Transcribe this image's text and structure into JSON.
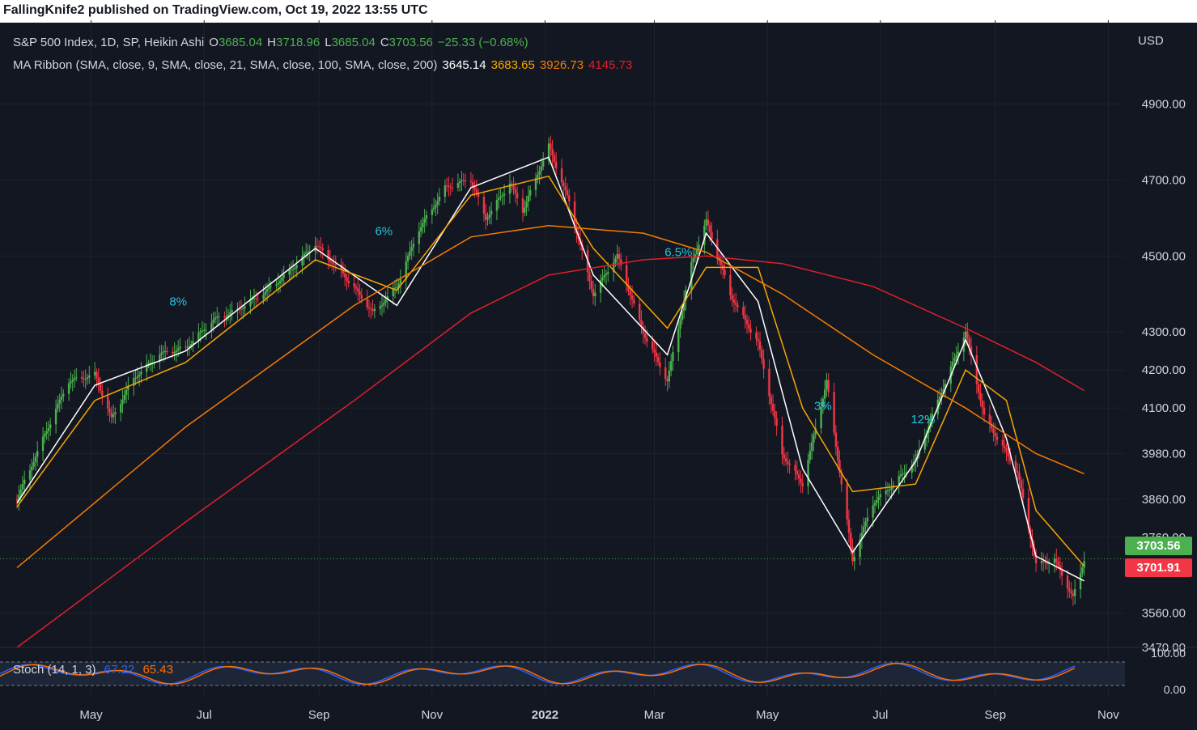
{
  "header": {
    "publisher": "FallingKnife2 published on TradingView.com, Oct 19, 2022 13:55 UTC"
  },
  "legend": {
    "symbol": "S&P 500 Index, 1D, SP, Heikin Ashi",
    "o_label": "O",
    "o_value": "3685.04",
    "h_label": "H",
    "h_value": "3718.96",
    "l_label": "L",
    "l_value": "3685.04",
    "c_label": "C",
    "c_value": "3703.56",
    "change": "−25.33 (−0.68%)",
    "ma_ribbon": "MA Ribbon (SMA, close, 9, SMA, close, 21, SMA, close, 100, SMA, close, 200)",
    "ma9": "3645.14",
    "ma21": "3683.65",
    "ma100": "3926.73",
    "ma200": "4145.73"
  },
  "currency": "USD",
  "price_badges": {
    "close": "3703.56",
    "ma": "3701.91"
  },
  "stoch": {
    "label": "Stoch (14, 1, 3)",
    "k": "67.22",
    "d": "65.43",
    "levels": [
      "100.00",
      "0.00"
    ]
  },
  "colors": {
    "up": "#4caf50",
    "down": "#f23645",
    "ma9": "#ffffff",
    "ma21": "#f7a600",
    "ma100": "#f57c00",
    "ma200": "#e0202a",
    "stoch_k": "#2962ff",
    "stoch_d": "#ff6d00",
    "annotation": "#26c6da"
  },
  "chart_data": {
    "type": "line",
    "title": "S&P 500 Index, 1D, SP, Heikin Ashi",
    "x_ticks": [
      "May",
      "Jul",
      "Sep",
      "Nov",
      "2022",
      "Mar",
      "May",
      "Jul",
      "Sep",
      "Nov"
    ],
    "y_ticks": [
      4900,
      4700,
      4500,
      4300,
      4200,
      4100,
      3980,
      3860,
      3760,
      3560,
      3470
    ],
    "ylim": [
      3470,
      4950
    ],
    "annotations": [
      "8%",
      "6%",
      "6.5%",
      "3%",
      "12%"
    ],
    "series": [
      {
        "name": "S&P 500 Index",
        "style": "heikin-ashi",
        "x": [
          "2021-03-22",
          "2021-04-05",
          "2021-04-19",
          "2021-05-03",
          "2021-05-12",
          "2021-05-24",
          "2021-06-07",
          "2021-06-21",
          "2021-07-06",
          "2021-07-19",
          "2021-08-02",
          "2021-08-16",
          "2021-08-30",
          "2021-09-13",
          "2021-09-30",
          "2021-10-13",
          "2021-10-25",
          "2021-11-08",
          "2021-11-22",
          "2021-11-30",
          "2021-12-13",
          "2021-12-20",
          "2022-01-03",
          "2022-01-14",
          "2022-01-27",
          "2022-02-09",
          "2022-02-23",
          "2022-03-08",
          "2022-03-21",
          "2022-03-29",
          "2022-04-11",
          "2022-04-26",
          "2022-05-09",
          "2022-05-20",
          "2022-06-02",
          "2022-06-16",
          "2022-06-27",
          "2022-07-08",
          "2022-07-20",
          "2022-08-01",
          "2022-08-16",
          "2022-08-26",
          "2022-09-07",
          "2022-09-13",
          "2022-09-23",
          "2022-10-03",
          "2022-10-13",
          "2022-10-19"
        ],
        "values": [
          3860,
          4020,
          4170,
          4190,
          4070,
          4180,
          4240,
          4260,
          4330,
          4360,
          4400,
          4460,
          4530,
          4460,
          4350,
          4420,
          4570,
          4680,
          4700,
          4600,
          4690,
          4620,
          4790,
          4640,
          4400,
          4500,
          4300,
          4170,
          4480,
          4590,
          4400,
          4270,
          3980,
          3900,
          4170,
          3700,
          3850,
          3900,
          3960,
          4120,
          4300,
          4080,
          3980,
          3930,
          3690,
          3700,
          3600,
          3703
        ]
      },
      {
        "name": "SMA 9",
        "x": [
          "2021-03-22",
          "2021-05-03",
          "2021-06-21",
          "2021-08-30",
          "2021-10-13",
          "2021-11-22",
          "2022-01-03",
          "2022-01-27",
          "2022-03-08",
          "2022-03-29",
          "2022-04-26",
          "2022-05-20",
          "2022-06-16",
          "2022-07-20",
          "2022-08-16",
          "2022-09-07",
          "2022-09-23",
          "2022-10-19"
        ],
        "values": [
          3850,
          4160,
          4250,
          4520,
          4370,
          4680,
          4760,
          4450,
          4240,
          4560,
          4380,
          3940,
          3720,
          3960,
          4280,
          4020,
          3710,
          3645
        ]
      },
      {
        "name": "SMA 21",
        "x": [
          "2021-03-22",
          "2021-05-03",
          "2021-06-21",
          "2021-08-30",
          "2021-10-13",
          "2021-11-22",
          "2022-01-03",
          "2022-01-27",
          "2022-03-08",
          "2022-03-29",
          "2022-04-26",
          "2022-05-20",
          "2022-06-16",
          "2022-07-20",
          "2022-08-16",
          "2022-09-07",
          "2022-09-23",
          "2022-10-19"
        ],
        "values": [
          3840,
          4120,
          4220,
          4490,
          4410,
          4660,
          4710,
          4520,
          4310,
          4470,
          4470,
          4100,
          3880,
          3900,
          4200,
          4120,
          3830,
          3684
        ]
      },
      {
        "name": "SMA 100",
        "x": [
          "2021-03-22",
          "2021-06-21",
          "2021-09-20",
          "2021-11-22",
          "2022-01-03",
          "2022-02-23",
          "2022-03-29",
          "2022-05-09",
          "2022-06-27",
          "2022-08-16",
          "2022-09-23",
          "2022-10-19"
        ],
        "values": [
          3680,
          4050,
          4370,
          4550,
          4580,
          4560,
          4510,
          4400,
          4240,
          4100,
          3980,
          3927
        ]
      },
      {
        "name": "SMA 200",
        "x": [
          "2021-03-22",
          "2021-06-21",
          "2021-09-20",
          "2021-11-22",
          "2022-01-03",
          "2022-02-23",
          "2022-03-29",
          "2022-05-09",
          "2022-06-27",
          "2022-08-16",
          "2022-09-23",
          "2022-10-19"
        ],
        "values": [
          3470,
          3800,
          4120,
          4350,
          4450,
          4490,
          4500,
          4480,
          4420,
          4310,
          4220,
          4146
        ]
      }
    ]
  }
}
